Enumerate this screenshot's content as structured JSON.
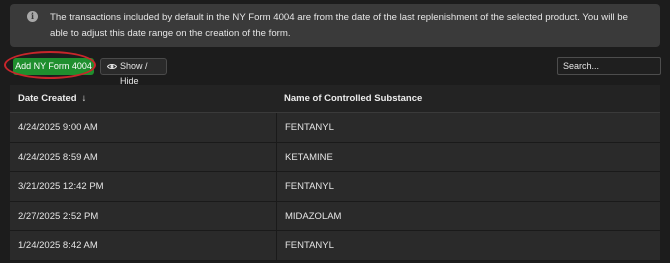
{
  "notice": {
    "text": "The transactions included by default in the NY Form 4004 are from the date of the last replenishment of the selected product. You will be able to adjust this date range on the creation of the form."
  },
  "toolbar": {
    "add_label": "Add NY Form 4004",
    "show_hide_label": "Show / Hide",
    "add_button_color": "#1f8f2e",
    "highlight_color": "#c8262b"
  },
  "search": {
    "placeholder": "Search..."
  },
  "table": {
    "columns": [
      {
        "label": "Date Created",
        "sort": "descending"
      },
      {
        "label": "Name of Controlled Substance"
      }
    ],
    "rows": [
      {
        "date": "4/24/2025 9:00 AM",
        "substance": "FENTANYL"
      },
      {
        "date": "4/24/2025 8:59 AM",
        "substance": "KETAMINE"
      },
      {
        "date": "3/21/2025 12:42 PM",
        "substance": "FENTANYL"
      },
      {
        "date": "2/27/2025 2:52 PM",
        "substance": "MIDAZOLAM"
      },
      {
        "date": "1/24/2025 8:42 AM",
        "substance": "FENTANYL"
      }
    ]
  }
}
